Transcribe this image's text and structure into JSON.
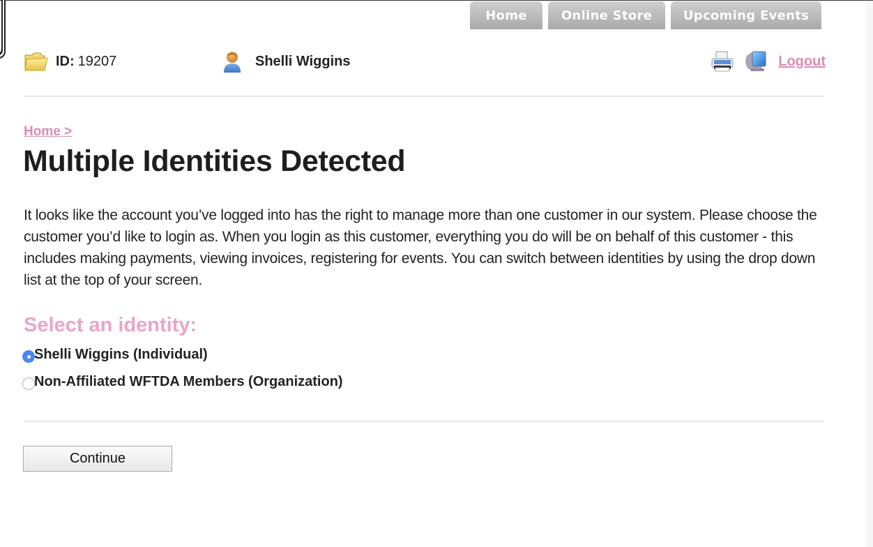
{
  "nav": {
    "tabs": [
      {
        "label": "Home"
      },
      {
        "label": "Online Store"
      },
      {
        "label": "Upcoming Events"
      }
    ]
  },
  "header": {
    "id_label": "ID:",
    "id_value": "19207",
    "user_name": "Shelli Wiggins",
    "logout_label": "Logout",
    "icons": {
      "id": "folder-icon",
      "user": "user-icon",
      "print": "printer-icon",
      "computer": "computer-icon"
    }
  },
  "breadcrumb": {
    "home_label": "Home >"
  },
  "page": {
    "title": "Multiple Identities Detected",
    "intro": "It looks like the account you’ve logged into has the right to manage more than one customer in our system. Please choose the customer you’d like to login as. When you login as this customer, everything you do will be on behalf of this customer - this includes making payments, viewing invoices, registering for events. You can switch between identities by using the drop down list at the top of your screen."
  },
  "identity": {
    "heading": "Select an identity:",
    "options": [
      {
        "label": "Shelli Wiggins (Individual)",
        "selected": true
      },
      {
        "label": "Non-Affiliated WFTDA Members (Organization)",
        "selected": false
      }
    ]
  },
  "actions": {
    "continue_label": "Continue"
  },
  "colors": {
    "accent_pink": "#d98cb3",
    "heading_pink": "#e8a6c8",
    "radio_selected": "#4a86f0",
    "tab_gray": "#b8b8b8"
  }
}
